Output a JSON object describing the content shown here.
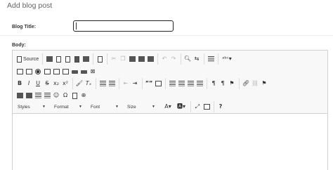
{
  "page": {
    "title": "Add blog post"
  },
  "form": {
    "blog_title_label": "Blog Title:",
    "blog_title_value": "",
    "body_label": "Body:"
  },
  "toolbar": {
    "source_label": "Source",
    "styles_label": "Styles",
    "format_label": "Format",
    "font_label": "Font",
    "size_label": "Size",
    "bold": "B",
    "italic": "I",
    "underline": "U",
    "strike": "S",
    "subscript": "x₂",
    "superscript": "x²",
    "remove_format": "Tₓ",
    "blockquote": "””",
    "ltr": "¶",
    "rtl": "¶",
    "omega": "Ω",
    "help": "?"
  }
}
